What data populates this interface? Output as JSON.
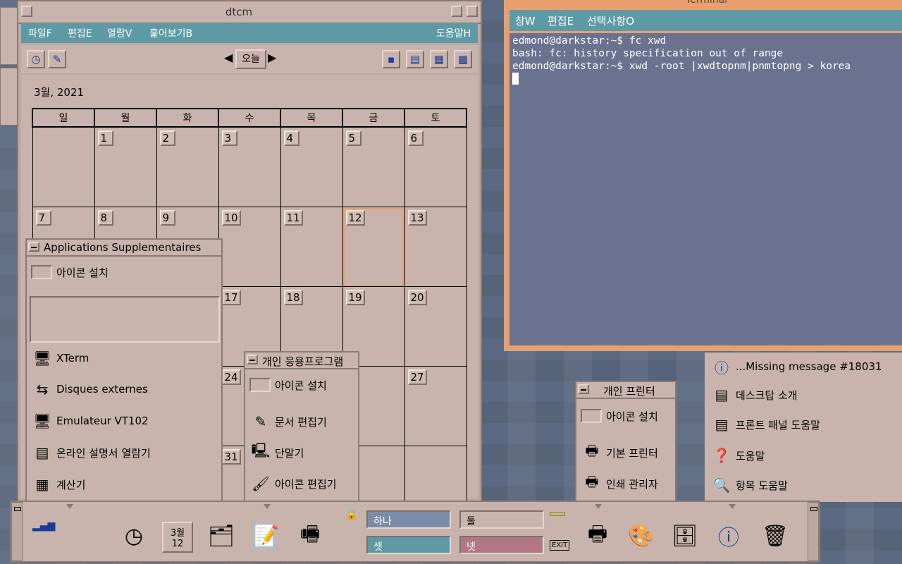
{
  "dtcm": {
    "title": "dtcm",
    "menu": [
      "파일F",
      "편집E",
      "열람V",
      "훑어보기B"
    ],
    "help_menu": "도움말H",
    "today_label": "오늘",
    "month_label": "3월, 2021",
    "weekdays": [
      "일",
      "월",
      "화",
      "수",
      "목",
      "금",
      "토"
    ],
    "weeks": [
      [
        "",
        "1",
        "2",
        "3",
        "4",
        "5",
        "6"
      ],
      [
        "7",
        "8",
        "9",
        "10",
        "11",
        "12",
        "13"
      ],
      [
        "",
        "",
        "",
        "17",
        "18",
        "19",
        "20"
      ],
      [
        "",
        "",
        "",
        "24",
        "",
        "",
        "27"
      ],
      [
        "",
        "",
        "",
        "31",
        "",
        "",
        ""
      ]
    ],
    "today": "12"
  },
  "terminal": {
    "title": "Terminal",
    "menu": [
      "창W",
      "편집E",
      "선택사항O"
    ],
    "lines": [
      "edmond@darkstar:~$ fc xwd",
      "bash: fc: history specification out of range",
      "edmond@darkstar:~$ xwd -root |xwdtopnm|pnmtopng > korea"
    ]
  },
  "apps_panel": {
    "title": "Applications Supplementaires",
    "install_label": "아이콘 설치",
    "items": [
      {
        "label": "XTerm",
        "icon": "xterm-icon"
      },
      {
        "label": "Disques externes",
        "icon": "usb-icon"
      },
      {
        "label": "Emulateur VT102",
        "icon": "vt102-icon"
      },
      {
        "label": "온라인 설명서 열람기",
        "icon": "manpage-icon"
      },
      {
        "label": "계산기",
        "icon": "calculator-icon"
      }
    ]
  },
  "personal_apps_panel": {
    "title": "개인 응용프로그램",
    "install_label": "아이콘 설치",
    "items": [
      {
        "label": "문서 편집기",
        "icon": "text-editor-icon"
      },
      {
        "label": "단말기",
        "icon": "terminal-icon"
      },
      {
        "label": "아이콘 편집기",
        "icon": "icon-editor-icon"
      }
    ]
  },
  "printers_panel": {
    "title": "개인 프린터",
    "install_label": "아이콘 설치",
    "items": [
      {
        "label": "기본 프린터",
        "icon": "printer-icon"
      },
      {
        "label": "인쇄 관리자",
        "icon": "print-manager-icon"
      }
    ]
  },
  "help_panel": {
    "items": [
      {
        "label": "...Missing message #18031",
        "icon": "info-icon"
      },
      {
        "label": "데스크탑 소개",
        "icon": "desktop-intro-icon"
      },
      {
        "label": "프론트 패널 도움말",
        "icon": "frontpanel-help-icon"
      },
      {
        "label": "도움말",
        "icon": "help-book-icon"
      },
      {
        "label": "항목 도움말",
        "icon": "item-help-icon"
      }
    ]
  },
  "frontpanel": {
    "workspaces": [
      "하나",
      "둘",
      "셋",
      "넷"
    ],
    "calendar_month": "3월",
    "calendar_day": "12",
    "exit_label": "EXIT",
    "colors": {
      "ws1": "#7a8ca8",
      "ws2": "#c8b4ac",
      "ws3": "#5e9aa6",
      "ws4": "#b07884"
    }
  }
}
